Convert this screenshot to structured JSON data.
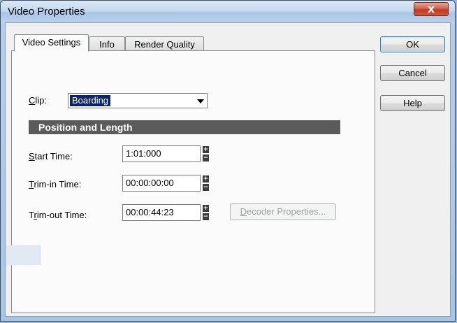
{
  "window": {
    "title": "Video Properties",
    "close_glyph": "x"
  },
  "tabs": [
    {
      "label": "Video Settings",
      "active": true
    },
    {
      "label": "Info",
      "active": false
    },
    {
      "label": "Render Quality",
      "active": false
    }
  ],
  "clip": {
    "label_mn": "C",
    "label_rest": "lip:",
    "value": "Boarding"
  },
  "section": {
    "title": "Position and Length"
  },
  "fields": {
    "start": {
      "label_mn": "S",
      "label_rest": "tart Time:",
      "value": "1:01:000"
    },
    "trim_in": {
      "label_mn": "T",
      "label_rest": "rim-in Time:",
      "value": "00:00:00:00"
    },
    "trim_out": {
      "label_pre": "T",
      "label_mn": "r",
      "label_rest": "im-out Time:",
      "value": "00:00:44:23"
    }
  },
  "decoder": {
    "label_mn": "D",
    "label_rest": "ecoder Properties..."
  },
  "buttons": {
    "ok": "OK",
    "cancel": "Cancel",
    "help": "Help"
  },
  "icons": {
    "spin_up": "+",
    "spin_down": "−"
  },
  "colors": {
    "section_bar": "#5b5b5b",
    "selection": "#0a246a",
    "close": "#c03a1f"
  }
}
